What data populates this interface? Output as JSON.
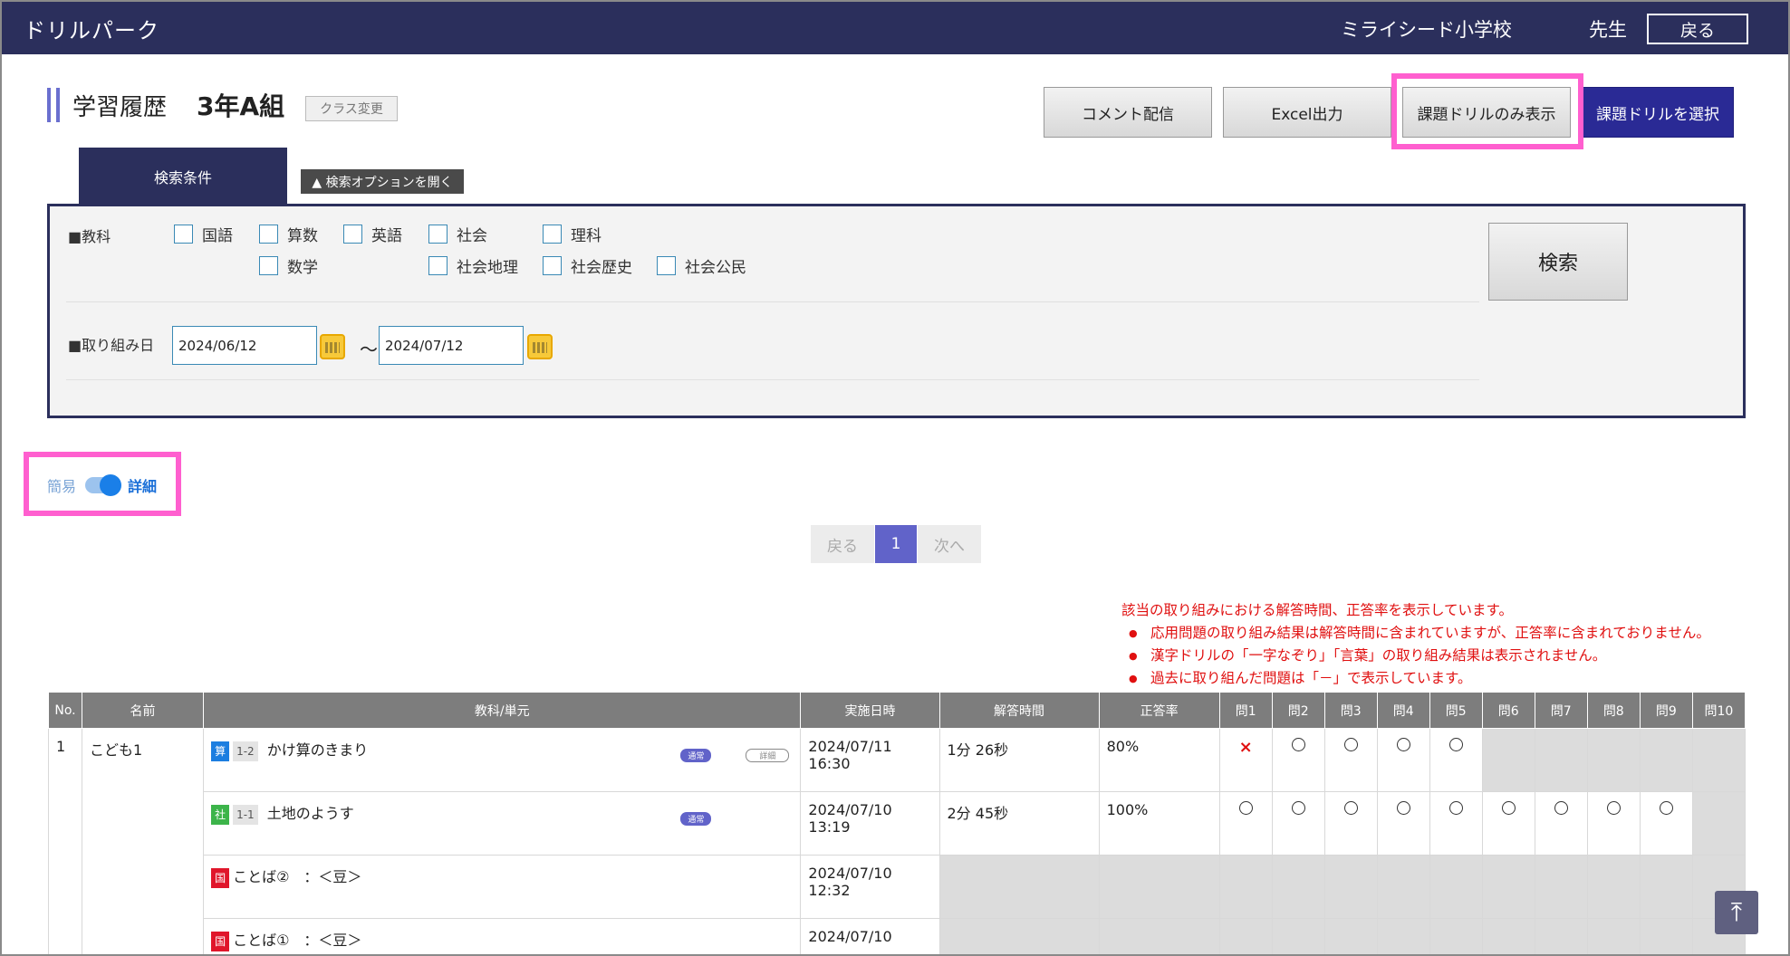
{
  "header": {
    "app_title": "ドリルパーク",
    "school": "ミライシード小学校",
    "teacher": "先生",
    "back": "戻る"
  },
  "title": {
    "page": "学習履歴",
    "class_name": "3年A組",
    "class_change": "クラス変更"
  },
  "actions": {
    "comment": "コメント配信",
    "excel": "Excel出力",
    "kadai_only": "課題ドリルのみ表示",
    "select_kadai": "課題ドリルを選択"
  },
  "search": {
    "tab": "検索条件",
    "open_options": "▲ 検索オプションを開く",
    "subject_label": "■教科",
    "subjects": [
      "国語",
      "算数",
      "英語",
      "社会",
      "理科",
      "数学",
      "社会地理",
      "社会歴史",
      "社会公民"
    ],
    "date_label": "■取り組み日",
    "date_from": "2024/06/12",
    "date_to": "2024/07/12",
    "tilde": "～",
    "search_button": "検索"
  },
  "view_toggle": {
    "simple": "簡易",
    "detail": "詳細",
    "state": "detail"
  },
  "pager": {
    "prev": "戻る",
    "current": "1",
    "next": "次へ"
  },
  "notes": {
    "head": "該当の取り組みにおける解答時間、正答率を表示しています。",
    "items": [
      "応用問題の取り組み結果は解答時間に含まれていますが、正答率に含まれておりません。",
      "漢字ドリルの「一字なぞり」「言葉」の取り組み結果は表示されません。",
      "過去に取り組んだ問題は「－」で表示しています。"
    ]
  },
  "table": {
    "headers": [
      "No.",
      "名前",
      "教科/単元",
      "実施日時",
      "解答時間",
      "正答率",
      "問1",
      "問2",
      "問3",
      "問4",
      "問5",
      "問6",
      "問7",
      "問8",
      "問9",
      "問10"
    ],
    "student_no": "1",
    "student_name": "こども1",
    "rows": [
      {
        "subject": "算",
        "unit": "1-2",
        "title": "かけ算のきまり",
        "tag_normal": "通常",
        "tag_detail": "詳細",
        "date": "2024/07/11",
        "time": "16:30",
        "duration": "1分 26秒",
        "rate": "80%"
      },
      {
        "subject": "社",
        "unit": "1-1",
        "title": "土地のようす",
        "tag_normal": "通常",
        "date": "2024/07/10",
        "time": "13:19",
        "duration": "2分 45秒",
        "rate": "100%"
      },
      {
        "subject": "国",
        "title": "ことば②　：＜豆＞",
        "date": "2024/07/10",
        "time": "12:32"
      },
      {
        "subject": "国",
        "title": "ことば①　：＜豆＞",
        "date": "2024/07/10"
      }
    ]
  },
  "scroll_top": "⤒"
}
